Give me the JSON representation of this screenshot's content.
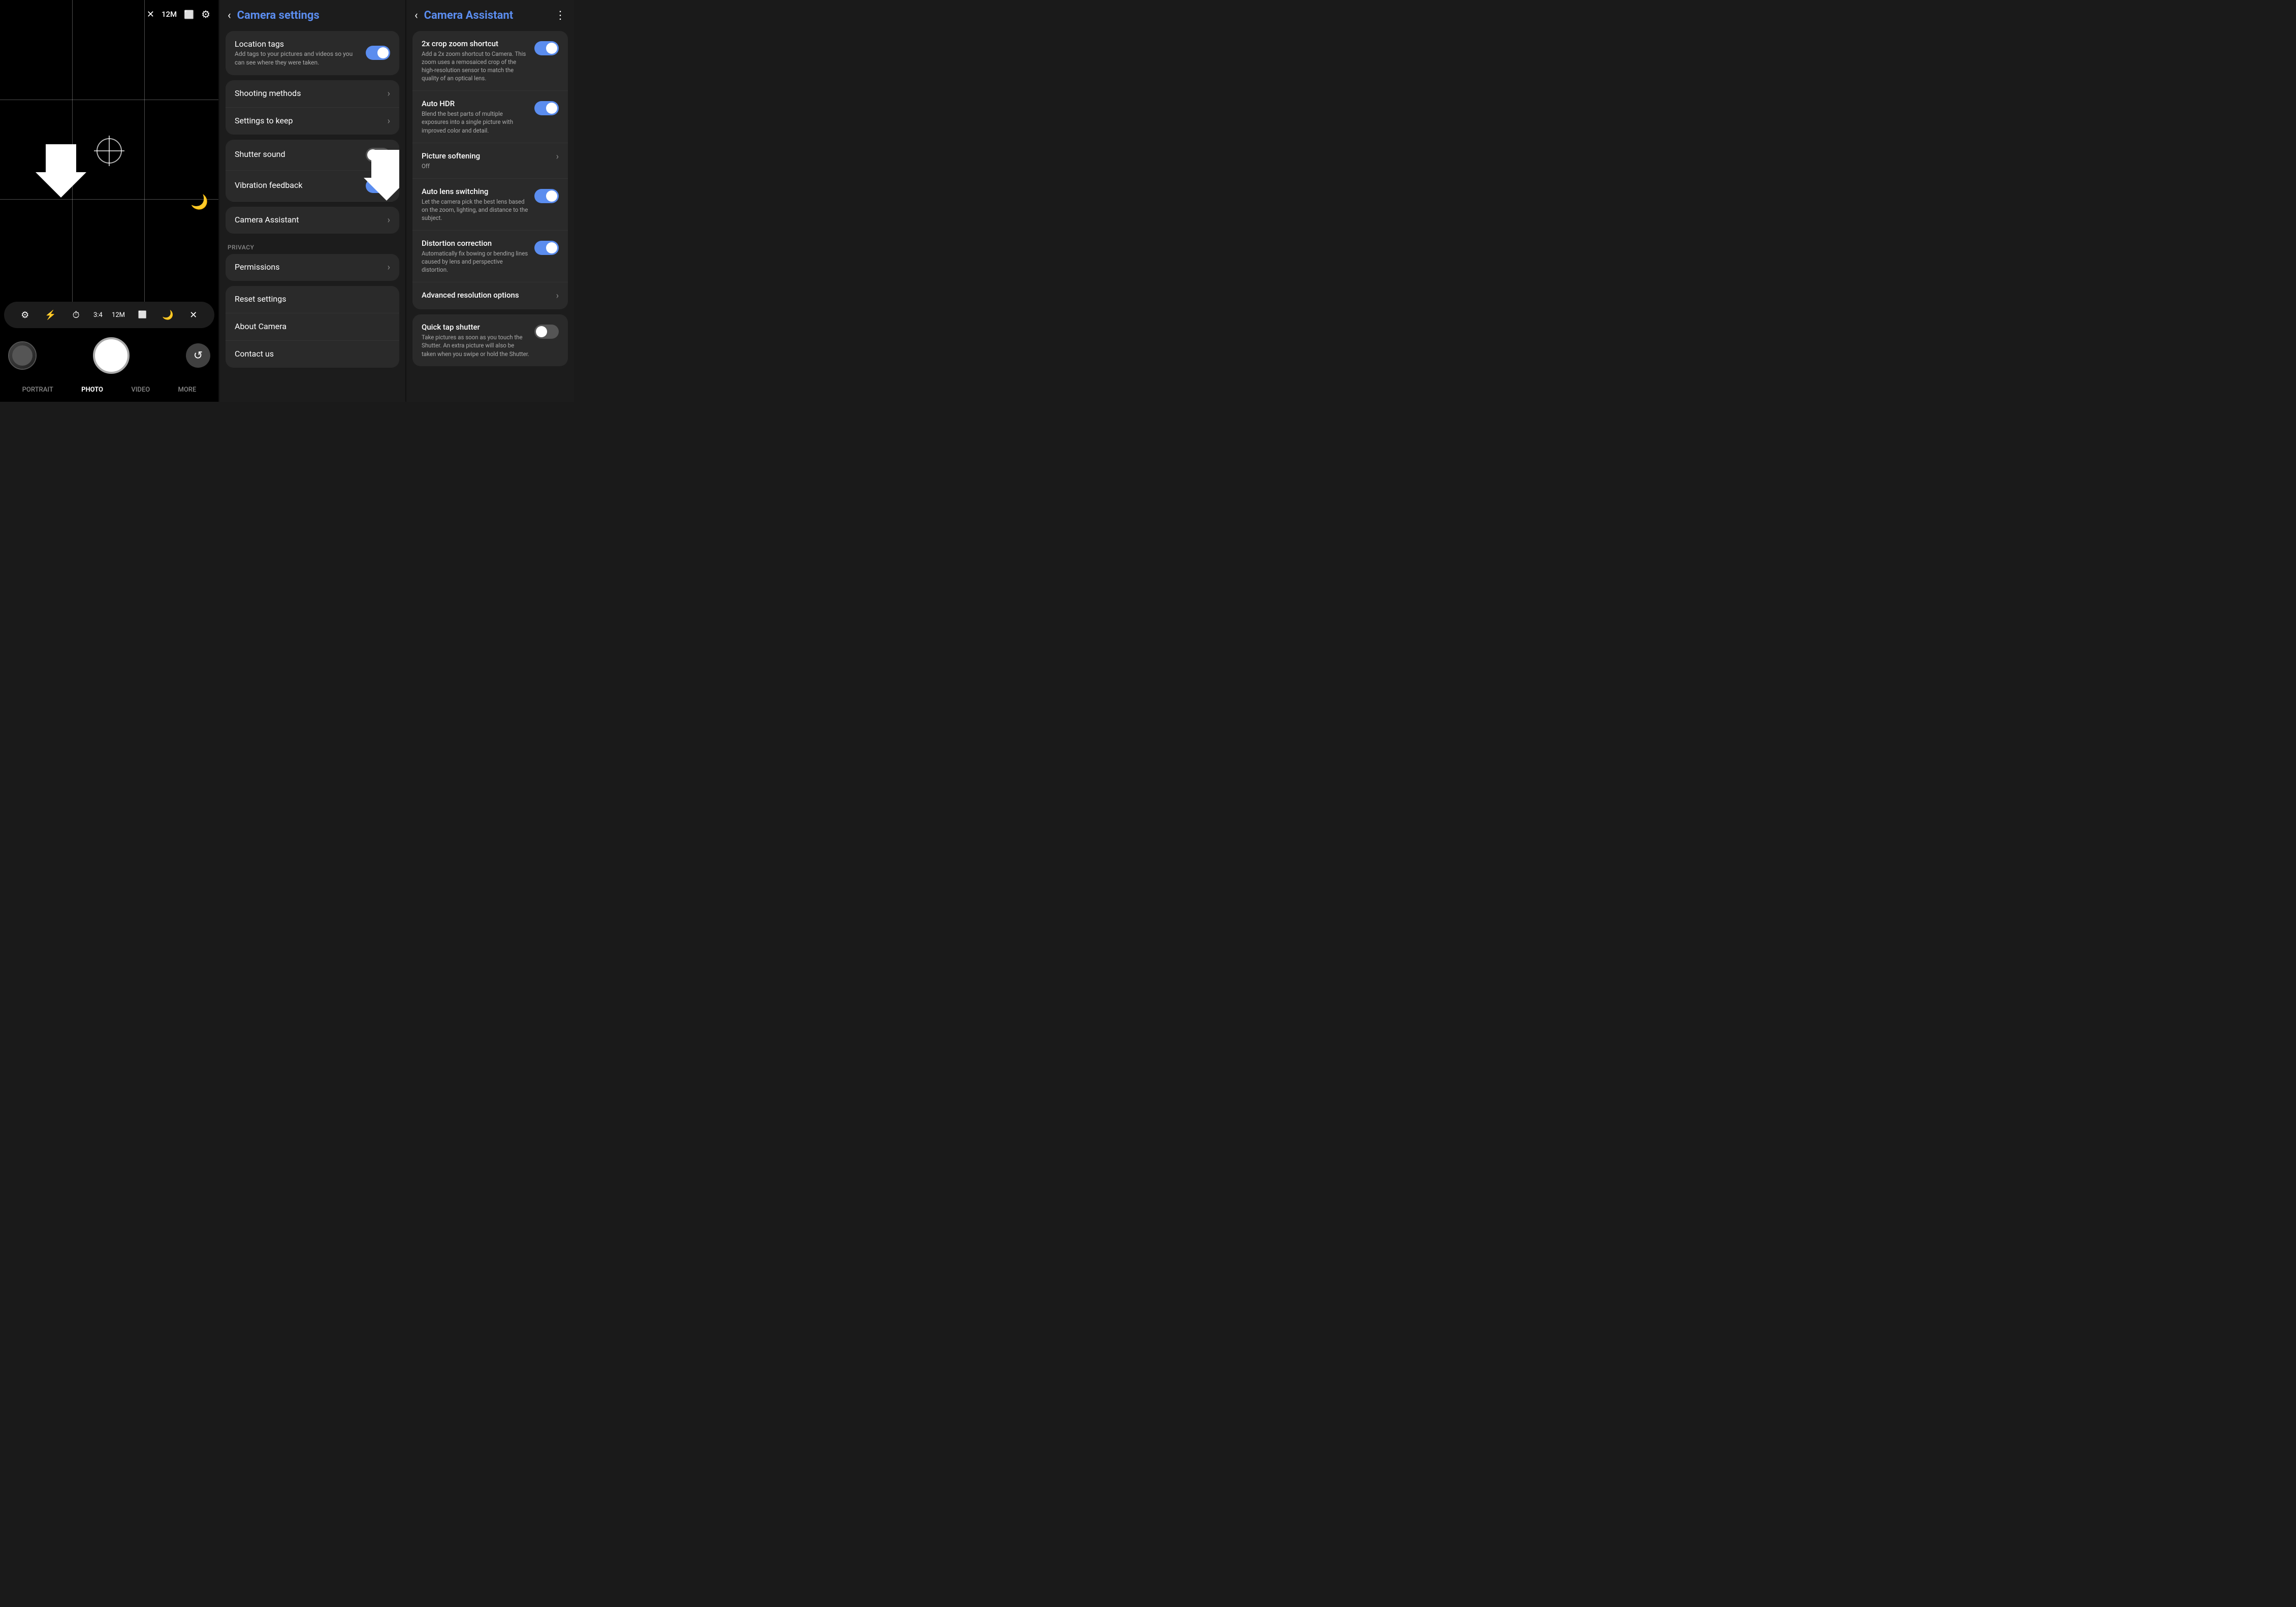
{
  "camera": {
    "res_badge": "12M",
    "top_icons": [
      "flash-off",
      "resolution",
      "settings"
    ],
    "grid": true,
    "toolbar": {
      "items": [
        "gear",
        "flash",
        "timer",
        "ratio",
        "megapixel",
        "photo-mode",
        "moon",
        "close"
      ]
    },
    "toolbar_labels": [
      "3:4",
      "12M"
    ],
    "modes": [
      "PORTRAIT",
      "PHOTO",
      "VIDEO",
      "MORE"
    ],
    "active_mode": "PHOTO"
  },
  "settings": {
    "title": "Camera settings",
    "back_label": "‹",
    "cards": [
      {
        "items": [
          {
            "title": "Location tags",
            "desc": "Add tags to your pictures and videos so you can see where they were taken.",
            "toggle": "on"
          }
        ]
      },
      {
        "items": [
          {
            "title": "Shooting methods",
            "desc": "",
            "toggle": null
          },
          {
            "title": "Settings to keep",
            "desc": "",
            "toggle": null
          }
        ]
      },
      {
        "items": [
          {
            "title": "Shutter sound",
            "desc": "",
            "toggle": "off"
          },
          {
            "title": "Vibration feedback",
            "desc": "",
            "toggle": "on"
          }
        ]
      },
      {
        "items": [
          {
            "title": "Camera Assistant",
            "desc": "",
            "toggle": null,
            "highlight": true
          }
        ]
      }
    ],
    "privacy_section": "Privacy",
    "privacy_card": [
      {
        "title": "Permissions",
        "desc": "",
        "toggle": null
      }
    ],
    "bottom_card": [
      {
        "title": "Reset settings",
        "desc": "",
        "toggle": null
      },
      {
        "title": "About Camera",
        "desc": "",
        "toggle": null
      },
      {
        "title": "Contact us",
        "desc": "",
        "toggle": null
      }
    ]
  },
  "assistant": {
    "title": "Camera Assistant",
    "back_label": "‹",
    "more_label": "⋮",
    "card1": [
      {
        "title": "2x crop zoom shortcut",
        "desc": "Add a 2x zoom shortcut to Camera. This zoom uses a remosaiced crop of the high-resolution sensor to match the quality of an optical lens.",
        "toggle": "on"
      },
      {
        "title": "Auto HDR",
        "desc": "Blend the best parts of multiple exposures into a single picture with improved color and detail.",
        "toggle": "on"
      },
      {
        "title": "Picture softening",
        "desc": "Off",
        "toggle": null,
        "value": ""
      },
      {
        "title": "Auto lens switching",
        "desc": "Let the camera pick the best lens based on the zoom, lighting, and distance to the subject.",
        "toggle": "on"
      },
      {
        "title": "Distortion correction",
        "desc": "Automatically fix bowing or bending lines caused by lens and perspective distortion.",
        "toggle": "on"
      },
      {
        "title": "Advanced resolution options",
        "desc": "",
        "toggle": null
      }
    ],
    "card2": [
      {
        "title": "Quick tap shutter",
        "desc": "Take pictures as soon as you touch the Shutter. An extra picture will also be taken when you swipe or hold the Shutter.",
        "toggle": "off"
      }
    ]
  }
}
